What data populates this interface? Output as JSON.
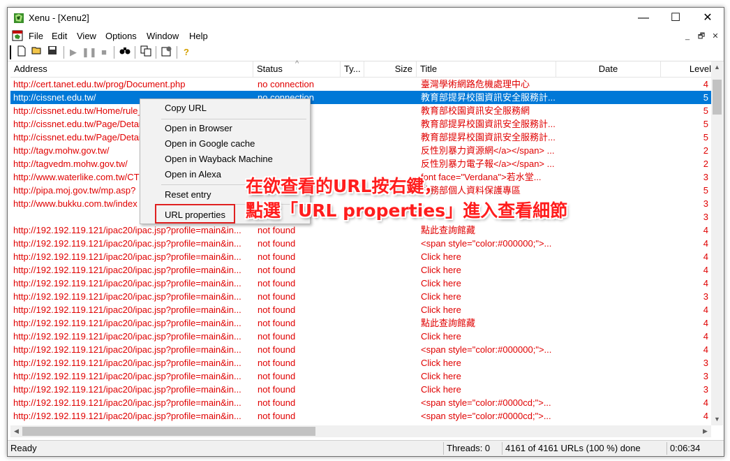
{
  "window": {
    "title": "Xenu - [Xenu2]",
    "minimize": "—",
    "maximize": "☐",
    "close": "✕"
  },
  "menu": {
    "items": [
      "File",
      "Edit",
      "View",
      "Options",
      "Window",
      "Help"
    ],
    "mdi_min": "_",
    "mdi_restore": "🗗",
    "mdi_close": "✕"
  },
  "toolbar": {
    "buttons": [
      "new-icon",
      "open-icon",
      "save-icon",
      "play-icon",
      "pause-icon",
      "stop-icon",
      "binoculars-icon",
      "copy-icon",
      "properties-icon",
      "help-icon"
    ]
  },
  "columns": {
    "address": "Address",
    "status": "Status",
    "type": "Ty...",
    "size": "Size",
    "title": "Title",
    "date": "Date",
    "level": "Level",
    "sort_indicator": "^"
  },
  "rows": [
    {
      "address": "http://cert.tanet.edu.tw/prog/Document.php",
      "status": "no connection",
      "title": "臺灣學術網路危機處理中心",
      "level": "4"
    },
    {
      "address": "http://cissnet.edu.tw/",
      "status": "no connection",
      "title": "教育部提昇校園資訊安全服務計...",
      "level": "5",
      "selected": true
    },
    {
      "address": "http://cissnet.edu.tw/Home/rule_",
      "status": "n",
      "title": "教育部校園資訊安全服務網",
      "level": "5"
    },
    {
      "address": "http://cissnet.edu.tw/Page/Detai",
      "status": "n",
      "title": "教育部提昇校園資訊安全服務計...",
      "level": "5"
    },
    {
      "address": "http://cissnet.edu.tw/Page/Detai",
      "status": "n",
      "title": "教育部提昇校園資訊安全服務計...",
      "level": "5"
    },
    {
      "address": "http://tagv.mohw.gov.tw/",
      "status": "n",
      "title": "反性別暴力資源網</a></span> ...",
      "level": "2"
    },
    {
      "address": "http://tagvedm.mohw.gov.tw/",
      "status": "n",
      "title": "反性別暴力電子報</a></span> ...",
      "level": "2"
    },
    {
      "address": "http://www.waterlike.com.tw/CT",
      "status": "n",
      "title": "font face=\"Verdana\">若水堂...",
      "level": "3"
    },
    {
      "address": "http://pipa.moj.gov.tw/mp.asp?",
      "status": "n",
      "title": "法務部個人資料保護專區",
      "level": "5"
    },
    {
      "address": "http://www.bukku.com.tw/index",
      "status": "n",
      "title": "",
      "level": "3"
    },
    {
      "address": "",
      "status": "",
      "title": "",
      "level": "3"
    },
    {
      "address": "http://192.192.119.121/ipac20/ipac.jsp?profile=main&in...",
      "status": "not found",
      "title": "點此查詢館藏",
      "level": "4"
    },
    {
      "address": "http://192.192.119.121/ipac20/ipac.jsp?profile=main&in...",
      "status": "not found",
      "title": "<span style=\"color:#000000;\">...",
      "level": "4"
    },
    {
      "address": "http://192.192.119.121/ipac20/ipac.jsp?profile=main&in...",
      "status": "not found",
      "title": "Click here",
      "level": "4"
    },
    {
      "address": "http://192.192.119.121/ipac20/ipac.jsp?profile=main&in...",
      "status": "not found",
      "title": "Click here",
      "level": "4"
    },
    {
      "address": "http://192.192.119.121/ipac20/ipac.jsp?profile=main&in...",
      "status": "not found",
      "title": "Click here",
      "level": "4"
    },
    {
      "address": "http://192.192.119.121/ipac20/ipac.jsp?profile=main&in...",
      "status": "not found",
      "title": "Click here",
      "level": "3"
    },
    {
      "address": "http://192.192.119.121/ipac20/ipac.jsp?profile=main&in...",
      "status": "not found",
      "title": "Click here",
      "level": "4"
    },
    {
      "address": "http://192.192.119.121/ipac20/ipac.jsp?profile=main&in...",
      "status": "not found",
      "title": "點此查詢館藏",
      "level": "4"
    },
    {
      "address": "http://192.192.119.121/ipac20/ipac.jsp?profile=main&in...",
      "status": "not found",
      "title": "Click here",
      "level": "4"
    },
    {
      "address": "http://192.192.119.121/ipac20/ipac.jsp?profile=main&in...",
      "status": "not found",
      "title": "<span style=\"color:#000000;\">...",
      "level": "4"
    },
    {
      "address": "http://192.192.119.121/ipac20/ipac.jsp?profile=main&in...",
      "status": "not found",
      "title": "Click here",
      "level": "3"
    },
    {
      "address": "http://192.192.119.121/ipac20/ipac.jsp?profile=main&in...",
      "status": "not found",
      "title": "Click here",
      "level": "3"
    },
    {
      "address": "http://192.192.119.121/ipac20/ipac.jsp?profile=main&in...",
      "status": "not found",
      "title": "Click here",
      "level": "3"
    },
    {
      "address": "http://192.192.119.121/ipac20/ipac.jsp?profile=main&in...",
      "status": "not found",
      "title": "<span style=\"color:#0000cd;\">...",
      "level": "4"
    },
    {
      "address": "http://192.192.119.121/ipac20/ipac.jsp?profile=main&in...",
      "status": "not found",
      "title": "<span style=\"color:#0000cd;\">...",
      "level": "4"
    }
  ],
  "context_menu": {
    "copy_url": "Copy URL",
    "open_browser": "Open in Browser",
    "open_google": "Open in Google cache",
    "open_wayback": "Open in Wayback Machine",
    "open_alexa": "Open in Alexa",
    "reset_entry": "Reset entry",
    "url_properties": "URL properties"
  },
  "annotation": {
    "line1": "在欲查看的URL按右鍵，",
    "line2": "點選「URL properties」進入查看細節"
  },
  "status": {
    "ready": "Ready",
    "threads": "Threads: 0",
    "progress": "4161 of 4161 URLs (100 %) done",
    "elapsed": "0:06:34"
  },
  "colors": {
    "broken_link": "#e00000",
    "selection": "#0078d7",
    "annotation": "#ff1d1d"
  }
}
